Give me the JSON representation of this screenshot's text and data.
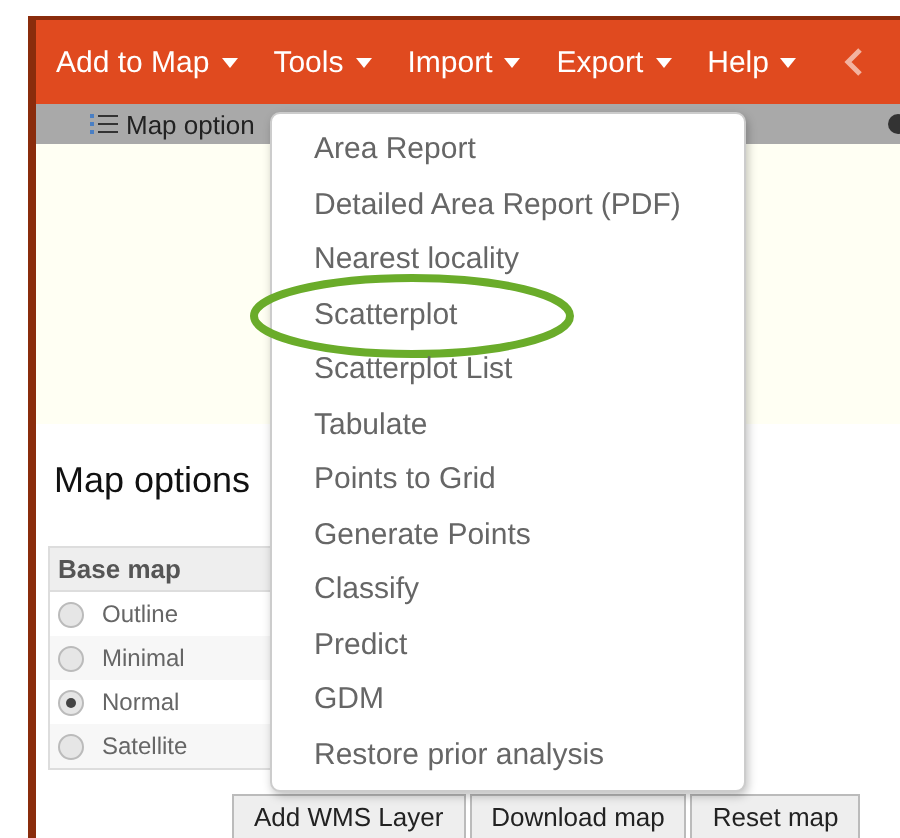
{
  "menubar": {
    "items": [
      {
        "label": "Add to Map"
      },
      {
        "label": "Tools"
      },
      {
        "label": "Import"
      },
      {
        "label": "Export"
      },
      {
        "label": "Help"
      }
    ]
  },
  "toolbar": {
    "label": "Map option"
  },
  "tools_menu": {
    "items": [
      {
        "label": "Area Report",
        "highlighted": false
      },
      {
        "label": "Detailed Area Report (PDF)",
        "highlighted": false
      },
      {
        "label": "Nearest locality",
        "highlighted": false
      },
      {
        "label": "Scatterplot",
        "highlighted": true
      },
      {
        "label": "Scatterplot List",
        "highlighted": false
      },
      {
        "label": "Tabulate",
        "highlighted": false
      },
      {
        "label": "Points to Grid",
        "highlighted": false
      },
      {
        "label": "Generate Points",
        "highlighted": false
      },
      {
        "label": "Classify",
        "highlighted": false
      },
      {
        "label": "Predict",
        "highlighted": false
      },
      {
        "label": "GDM",
        "highlighted": false
      },
      {
        "label": "Restore prior analysis",
        "highlighted": false
      }
    ]
  },
  "map_options": {
    "title": "Map options",
    "base_map": {
      "header": "Base map",
      "options": [
        {
          "label": "Outline",
          "selected": false
        },
        {
          "label": "Minimal",
          "selected": false
        },
        {
          "label": "Normal",
          "selected": true
        },
        {
          "label": "Satellite",
          "selected": false
        }
      ]
    }
  },
  "buttons": [
    "Add WMS Layer",
    "Download map",
    "Reset map"
  ]
}
